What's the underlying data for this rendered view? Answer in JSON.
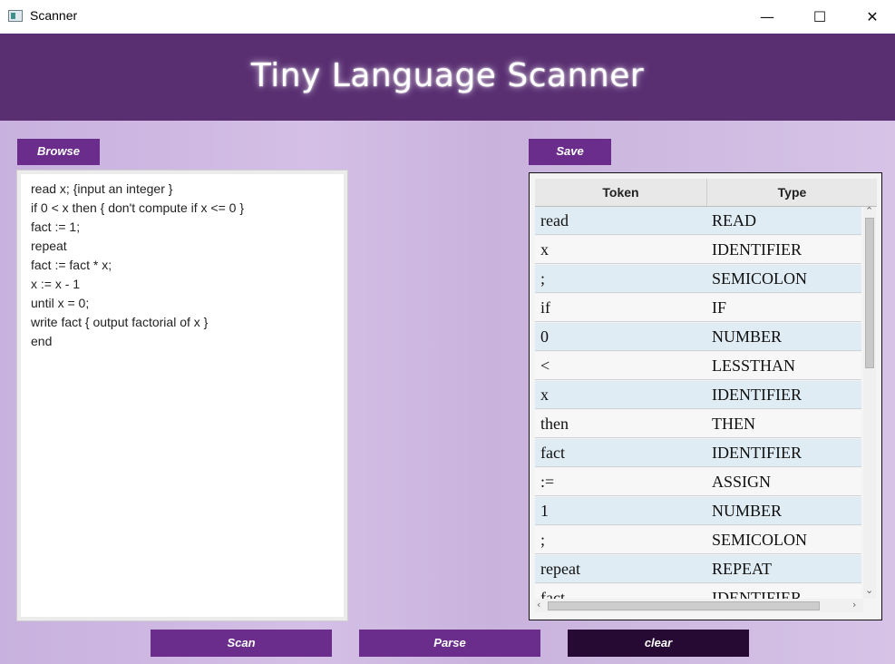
{
  "window": {
    "title": "Scanner",
    "minimize": "—",
    "maximize": "☐",
    "close": "✕"
  },
  "header": {
    "title": "Tiny Language Scanner"
  },
  "buttons": {
    "browse": "Browse",
    "save": "Save",
    "scan": "Scan",
    "parse": "Parse",
    "clear": "clear"
  },
  "editor": {
    "lines": [
      "read x; {input an integer }",
      "if 0 < x then { don't compute if x <= 0 }",
      "fact := 1;",
      "repeat",
      "fact := fact * x;",
      "x := x - 1",
      "until x = 0;",
      "write fact { output factorial of x }",
      "end"
    ]
  },
  "table": {
    "columns": [
      "Token",
      "Type"
    ],
    "rows": [
      [
        "read",
        "READ"
      ],
      [
        "x",
        "IDENTIFIER"
      ],
      [
        ";",
        "SEMICOLON"
      ],
      [
        "if",
        "IF"
      ],
      [
        "0",
        "NUMBER"
      ],
      [
        "<",
        "LESSTHAN"
      ],
      [
        "x",
        "IDENTIFIER"
      ],
      [
        "then",
        "THEN"
      ],
      [
        "fact",
        "IDENTIFIER"
      ],
      [
        ":=",
        "ASSIGN"
      ],
      [
        "1",
        "NUMBER"
      ],
      [
        ";",
        "SEMICOLON"
      ],
      [
        "repeat",
        "REPEAT"
      ],
      [
        "fact",
        "IDENTIFIER"
      ]
    ]
  },
  "colors": {
    "header": "#592f72",
    "button": "#6b2d8c",
    "clear_button": "#270a33",
    "row_alt": "#e0ecf3"
  }
}
